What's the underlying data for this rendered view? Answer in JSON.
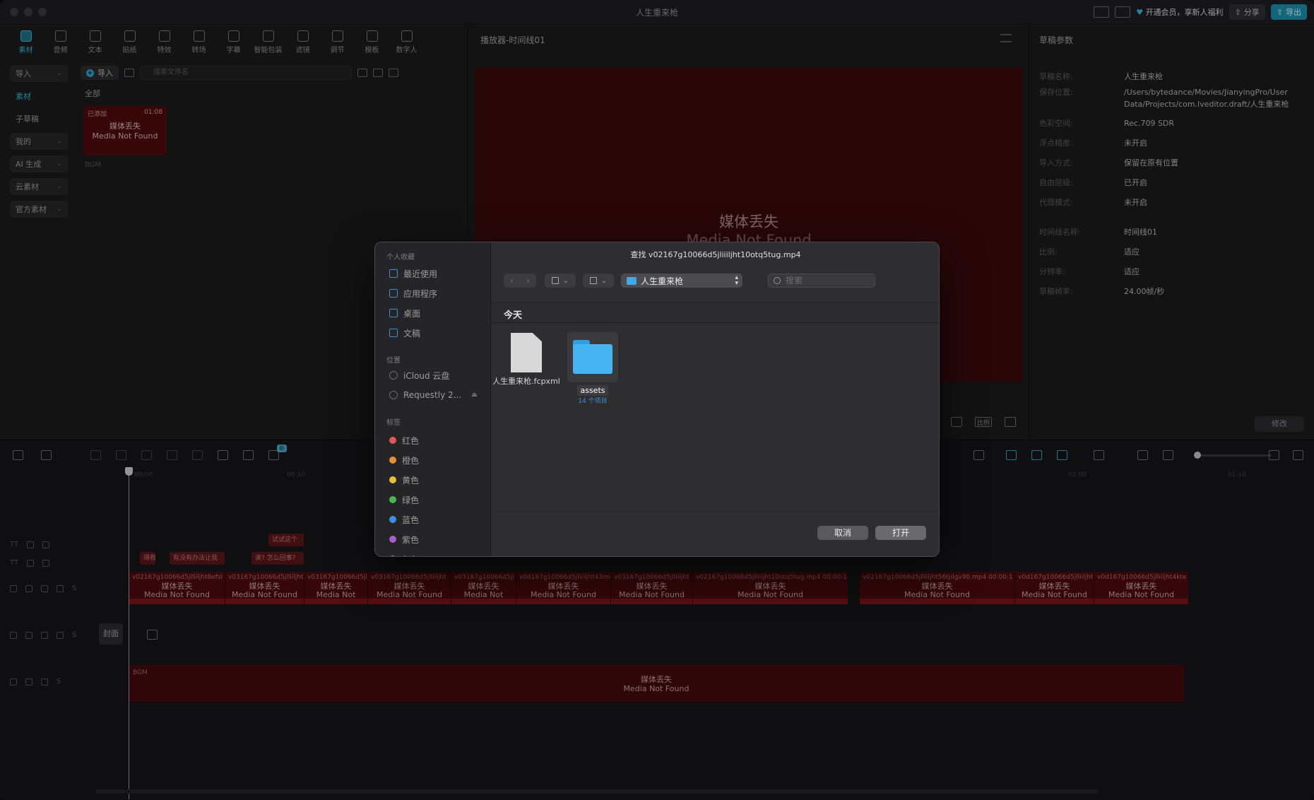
{
  "window": {
    "title": "人生重来枪"
  },
  "titlebar_right": {
    "vip_text": "开通会员，享新人福利",
    "share_label": "分享",
    "export_label": "导出"
  },
  "toolbar": {
    "items": [
      {
        "label": "素材",
        "icon": "media-icon"
      },
      {
        "label": "音频",
        "icon": "audio-icon"
      },
      {
        "label": "文本",
        "icon": "text-icon"
      },
      {
        "label": "贴纸",
        "icon": "sticker-icon"
      },
      {
        "label": "特效",
        "icon": "effects-icon"
      },
      {
        "label": "转场",
        "icon": "transition-icon"
      },
      {
        "label": "字幕",
        "icon": "caption-icon"
      },
      {
        "label": "智能包装",
        "icon": "smart-pack-icon"
      },
      {
        "label": "滤镜",
        "icon": "filter-icon"
      },
      {
        "label": "调节",
        "icon": "adjust-icon"
      },
      {
        "label": "模板",
        "icon": "template-icon"
      },
      {
        "label": "数字人",
        "icon": "avatar-icon"
      }
    ]
  },
  "sidebar": {
    "items": [
      {
        "label": "导入"
      },
      {
        "label": "素材"
      },
      {
        "label": "子草稿"
      },
      {
        "label": "我的"
      },
      {
        "label": "AI 生成"
      },
      {
        "label": "云素材"
      },
      {
        "label": "官方素材"
      }
    ]
  },
  "media": {
    "import_label": "导入",
    "search_placeholder": "搜索文件名",
    "all_label": "全部",
    "thumb": {
      "added": "已添加",
      "duration": "01:08",
      "title_cn": "媒体丢失",
      "title_en": "Media Not Found",
      "caption": "BGM"
    }
  },
  "player": {
    "title": "播放器-时间线01",
    "missing_cn": "媒体丢失",
    "missing_en": "Media Not Found",
    "ratio_label": "比例"
  },
  "properties": {
    "title": "草稿参数",
    "rows": [
      {
        "key": "草稿名称:",
        "value": "人生重来枪"
      },
      {
        "key": "保存位置:",
        "value": "/Users/bytedance/Movies/JianyingPro/User Data/Projects/com.lveditor.draft/人生重来枪"
      },
      {
        "key": "色彩空间:",
        "value": "Rec.709 SDR"
      },
      {
        "key": "浮点精度:",
        "value": "未开启"
      },
      {
        "key": "导入方式:",
        "value": "保留在原有位置"
      },
      {
        "key": "自由层级:",
        "value": "已开启"
      },
      {
        "key": "代理模式:",
        "value": "未开启"
      },
      {
        "key": "时间线名称:",
        "value": "时间线01"
      },
      {
        "key": "比例:",
        "value": "适应"
      },
      {
        "key": "分辨率:",
        "value": "适应"
      },
      {
        "key": "草稿帧率:",
        "value": "24.00帧/秒"
      }
    ],
    "modify_label": "修改"
  },
  "timeline": {
    "ruler": [
      "00:00",
      "00:10",
      "01:00",
      "01:10"
    ],
    "text_clips": [
      {
        "label": "试试这个",
        "row": 0
      },
      {
        "label": "得救",
        "row": 1
      },
      {
        "label": "有没有办法让我",
        "row": 1
      },
      {
        "label": "诶? 怎么回事?",
        "row": 1
      }
    ],
    "video_clips": [
      {
        "file": "v02167g10066d5jlliiljht8efsl",
        "cn": "媒体丢失",
        "en": "Media Not Found"
      },
      {
        "file": "v03167g10066d5jlliiljht",
        "cn": "媒体丢失",
        "en": "Media Not Found"
      },
      {
        "file": "v03167g10066d5jl",
        "cn": "媒体丢失",
        "en": "Media Not Found"
      },
      {
        "file": "v03167g10066d5jlliiljht",
        "cn": "媒体丢失",
        "en": "Media Not Found"
      },
      {
        "file": "v03167g10066d5jl",
        "cn": "媒体丢失",
        "en": "Media Not Found"
      },
      {
        "file": "v0d167g10066d5jlliiljht43mi",
        "cn": "媒体丢失",
        "en": "Media Not Found"
      },
      {
        "file": "v03167g10066d5jlliiljht",
        "cn": "媒体丢失",
        "en": "Media Not Found"
      },
      {
        "file": "v02167g10066d5jlliiljht10otq5tug.mp4  00:00:1",
        "cn": "媒体丢失",
        "en": "Media Not Found"
      },
      {
        "file": "v02167g10066d5jlliiljht56tjdgv90.mp4  00:00:1",
        "cn": "媒体丢失",
        "en": "Media Not Found"
      },
      {
        "file": "v0d167g10066d5jlliiljht",
        "cn": "媒体丢失",
        "en": "Media Not Found"
      },
      {
        "file": "v0d167g10066d5jlliiljht4kte",
        "cn": "媒体丢失",
        "en": "Media Not Found"
      }
    ],
    "cover_label": "封面",
    "audio": {
      "tag": "BGM",
      "cn": "媒体丢失",
      "en": "Media Not Found"
    },
    "badge": "新"
  },
  "dialog": {
    "title": "查找 v02167g10066d5jliiiljht10otq5tug.mp4",
    "favorites_label": "个人收藏",
    "favorites": [
      "最近使用",
      "应用程序",
      "桌面",
      "文稿"
    ],
    "locations_label": "位置",
    "locations": [
      "iCloud 云盘",
      "Requestly 2..."
    ],
    "tags_label": "标签",
    "tags": [
      {
        "label": "红色",
        "color": "#e05757"
      },
      {
        "label": "橙色",
        "color": "#e5903b"
      },
      {
        "label": "黄色",
        "color": "#e3c23a"
      },
      {
        "label": "绿色",
        "color": "#4cb552"
      },
      {
        "label": "蓝色",
        "color": "#3d8fe0"
      },
      {
        "label": "紫色",
        "color": "#a45ed1"
      },
      {
        "label": "灰色",
        "color": "#8a8a8a"
      }
    ],
    "path": "人生重来枪",
    "search_placeholder": "搜索",
    "section_today": "今天",
    "files": [
      {
        "name": "人生重来枪.fcpxml",
        "type": "document"
      },
      {
        "name": "assets",
        "type": "folder",
        "sub": "14 个项目"
      }
    ],
    "cancel_label": "取消",
    "open_label": "打开"
  }
}
